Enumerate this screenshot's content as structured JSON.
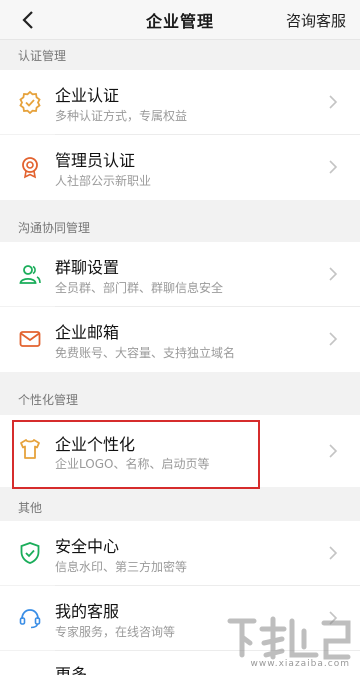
{
  "header": {
    "title": "企业管理",
    "right_action": "咨询客服"
  },
  "sections": {
    "auth": "认证管理",
    "collab": "沟通协同管理",
    "personal": "个性化管理",
    "other": "其他"
  },
  "items": {
    "enterprise_auth": {
      "name": "企业认证",
      "desc": "多种认证方式，专属权益"
    },
    "admin_auth": {
      "name": "管理员认证",
      "desc": "人社部公示新职业"
    },
    "group_settings": {
      "name": "群聊设置",
      "desc": "全员群、部门群、群聊信息安全"
    },
    "enterprise_mail": {
      "name": "企业邮箱",
      "desc": "免费账号、大容量、支持独立域名"
    },
    "personalization": {
      "name": "企业个性化",
      "desc": "企业LOGO、名称、启动页等"
    },
    "security_center": {
      "name": "安全中心",
      "desc": "信息水印、第三方加密等"
    },
    "my_service": {
      "name": "我的客服",
      "desc": "专家服务，在线咨询等"
    },
    "more": {
      "name": "更多"
    }
  },
  "colors": {
    "accent_green": "#1aad5a",
    "accent_orange": "#e6a23c",
    "accent_red_orange": "#e2622f",
    "accent_blue": "#3a8ee6",
    "highlight_red": "#d62c2c"
  },
  "watermark": {
    "text": "www.xiazaiba.com"
  }
}
